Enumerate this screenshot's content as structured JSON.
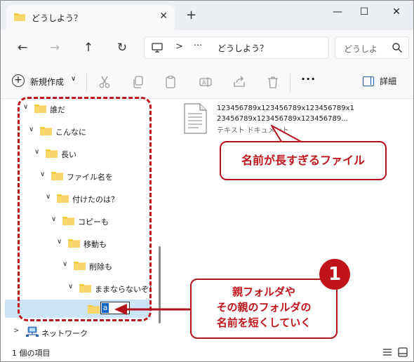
{
  "window": {
    "tab_title": "どうしよう？",
    "new_tab": "+",
    "minimize": "—",
    "maximize": "☐",
    "close": "✕"
  },
  "navigation": {
    "back": "←",
    "forward": "→",
    "up": "↑",
    "refresh": "↻",
    "address_separator": ">",
    "address_more": "···",
    "address_text": "どうしよう？",
    "search_placeholder": "どうしよ"
  },
  "toolbar": {
    "new_label": "新規作成",
    "new_chevron": "∨",
    "more": "···",
    "details_label": "詳細"
  },
  "tree": {
    "items": [
      {
        "label": "誰だ"
      },
      {
        "label": "こんなに"
      },
      {
        "label": "長い"
      },
      {
        "label": "ファイル名を"
      },
      {
        "label": "付けたのは？"
      },
      {
        "label": "コピーも"
      },
      {
        "label": "移動も"
      },
      {
        "label": "削除も"
      },
      {
        "label": "ままならないぞ！"
      }
    ],
    "rename_value": "a",
    "network_label": "ネットワーク"
  },
  "content": {
    "file_name_line1": "123456789x123456789x123456789x1",
    "file_name_line2": "23456789x123456789x123456789...",
    "file_type": "テキスト ドキュメント"
  },
  "status": {
    "item_count": "1 個の項目"
  },
  "annotations": {
    "callout1": "名前が長すぎるファイル",
    "callout2_line1": "親フォルダや",
    "callout2_line2": "その親のフォルダの",
    "callout2_line3": "名前を短くしていく",
    "badge": "1"
  },
  "colors": {
    "accent_red": "#c0141a",
    "folder_yellow": "#f6c844",
    "selection_blue": "#cde4f7"
  }
}
